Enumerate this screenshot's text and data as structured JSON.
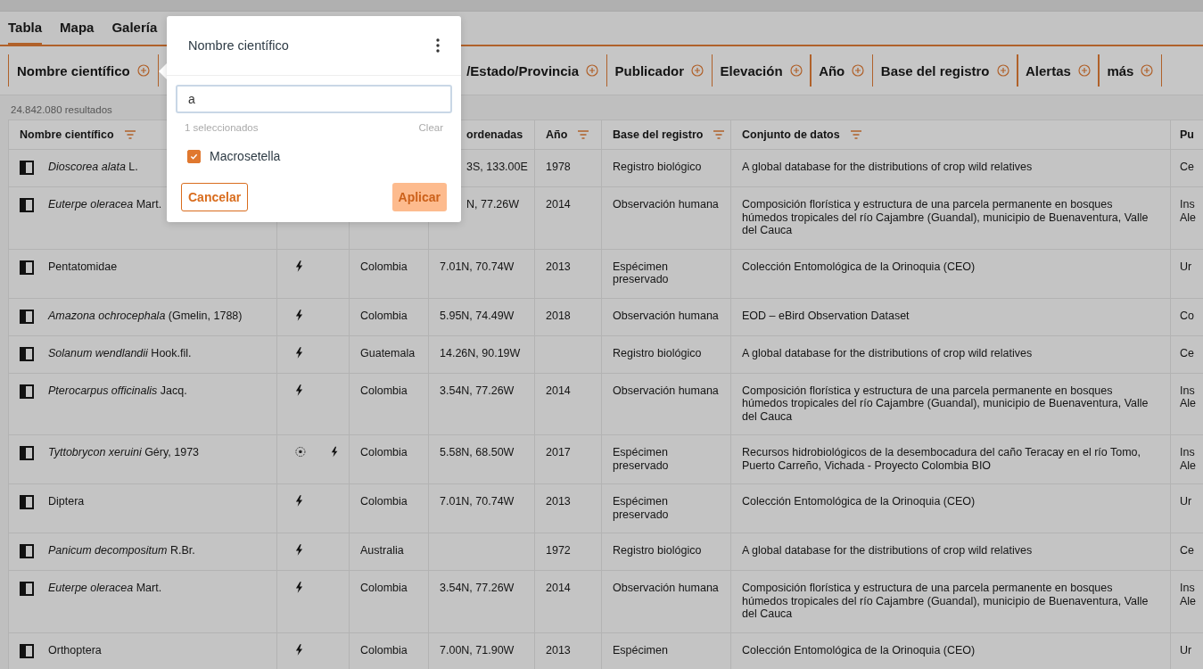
{
  "tabs": [
    {
      "label": "Tabla",
      "selected": true
    },
    {
      "label": "Mapa",
      "selected": false
    },
    {
      "label": "Galería",
      "selected": false
    }
  ],
  "filters": [
    {
      "label": "Nombre científico"
    },
    {
      "label": "/Estado/Provincia",
      "clipped": true
    },
    {
      "label": "Publicador"
    },
    {
      "label": "Elevación"
    },
    {
      "label": "Año"
    },
    {
      "label": "Base del registro"
    },
    {
      "label": "Alertas"
    },
    {
      "label": "más"
    }
  ],
  "results": "24.842.080 resultados",
  "table": {
    "columns": [
      {
        "label": "Nombre científico",
        "filter": true
      },
      {},
      {},
      {
        "label": "ordenadas",
        "clipped": true
      },
      {
        "label": "Año",
        "filter": true
      },
      {
        "label": "Base del registro",
        "filter": true
      },
      {
        "label": "Conjunto de datos",
        "filter": true
      },
      {
        "label": "Pu"
      }
    ],
    "rows": [
      {
        "name": "*Dioscorea alata* L.",
        "coords": "3S, 133.00E",
        "coords_clipped": true,
        "year": "1978",
        "basis": "Registro biológico",
        "dataset": "A global database for the distributions of crop wild relatives",
        "column_8": "Ce"
      },
      {
        "name": "*Euterpe oleracea* Mart.",
        "coords": "N, 77.26W",
        "coords_clipped": true,
        "year": "2014",
        "basis": "Observación humana",
        "dataset": "Composición florística y estructura de una parcela permanente en bosques húmedos tropicales del río Cajambre (Guandal), municipio de Buenaventura, Valle del Cauca",
        "column_8": "Ins\nAle"
      },
      {
        "name": "Pentatomidae",
        "flags": [
          {
            "kind": "bolt"
          }
        ],
        "country": "Colombia",
        "coords": "7.01N, 70.74W",
        "year": "2013",
        "basis": "Espécimen preservado",
        "dataset": "Colección Entomológica de la Orinoquia (CEO)",
        "column_8": "Ur"
      },
      {
        "name": "*Amazona ochrocephala* (Gmelin, 1788)",
        "flags": [
          {
            "kind": "bolt"
          }
        ],
        "country": "Colombia",
        "coords": "5.95N, 74.49W",
        "year": "2018",
        "basis": "Observación humana",
        "dataset": "EOD – eBird Observation Dataset",
        "column_8": "Co"
      },
      {
        "name": "*Solanum wendlandii* Hook.fil.",
        "flags": [
          {
            "kind": "bolt"
          }
        ],
        "country": "Guatemala",
        "coords": "14.26N, 90.19W",
        "basis": "Registro biológico",
        "dataset": "A global database for the distributions of crop wild relatives",
        "column_8": "Ce"
      },
      {
        "name": "*Pterocarpus officinalis* Jacq.",
        "flags": [
          {
            "kind": "bolt"
          }
        ],
        "country": "Colombia",
        "coords": "3.54N, 77.26W",
        "year": "2014",
        "basis": "Observación humana",
        "dataset": "Composición florística y estructura de una parcela permanente en bosques húmedos tropicales del río Cajambre (Guandal), municipio de Buenaventura, Valle del Cauca",
        "column_8": "Ins\nAle"
      },
      {
        "name": "*Tyttobrycon xeruini* Géry, 1973",
        "flags": [
          {
            "kind": "ball"
          },
          {
            "kind": "bolt"
          }
        ],
        "country": "Colombia",
        "coords": "5.58N, 68.50W",
        "year": "2017",
        "basis": "Espécimen preservado",
        "dataset": "Recursos hidrobiológicos de la desembocadura del caño Teracay en el río Tomo, Puerto Carreño, Vichada - Proyecto Colombia BIO",
        "column_8": "Ins\nAle"
      },
      {
        "name": "Diptera",
        "flags": [
          {
            "kind": "bolt"
          }
        ],
        "country": "Colombia",
        "coords": "7.01N, 70.74W",
        "year": "2013",
        "basis": "Espécimen preservado",
        "dataset": "Colección Entomológica de la Orinoquia (CEO)",
        "column_8": "Ur"
      },
      {
        "name": "*Panicum decompositum* R.Br.",
        "flags": [
          {
            "kind": "bolt"
          }
        ],
        "country": "Australia",
        "year": "1972",
        "basis": "Registro biológico",
        "dataset": "A global database for the distributions of crop wild relatives",
        "column_8": "Ce"
      },
      {
        "name": "*Euterpe oleracea* Mart.",
        "flags": [
          {
            "kind": "bolt"
          }
        ],
        "country": "Colombia",
        "coords": "3.54N, 77.26W",
        "year": "2014",
        "basis": "Observación humana",
        "dataset": "Composición florística y estructura de una parcela permanente en bosques húmedos tropicales del río Cajambre (Guandal), municipio de Buenaventura, Valle del Cauca",
        "column_8": "Ins\nAle"
      },
      {
        "name": "Orthoptera",
        "flags": [
          {
            "kind": "bolt"
          }
        ],
        "country": "Colombia",
        "coords": "7.00N, 71.90W",
        "year": "2013",
        "basis": "Espécimen",
        "dataset": "Colección Entomológica de la Orinoquia (CEO)",
        "column_8": "Ur"
      }
    ]
  },
  "popover": {
    "title": "Nombre científico",
    "search": {
      "value": "a"
    },
    "selected_count": "1 seleccionados",
    "clear": "Clear",
    "options": [
      {
        "label": "Macrosetella",
        "checked": true
      }
    ],
    "cancel": "Cancelar",
    "apply": "Aplicar"
  }
}
